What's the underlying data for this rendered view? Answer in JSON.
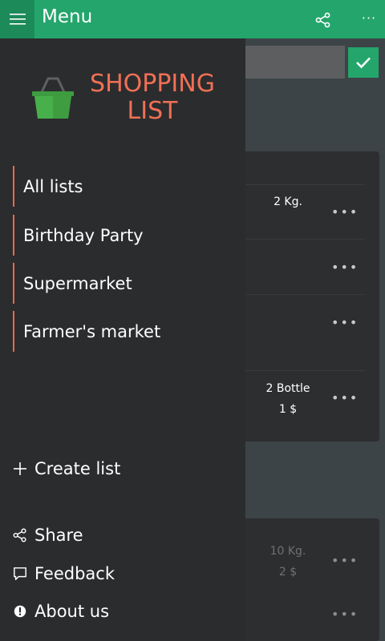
{
  "header": {
    "title": "Menu",
    "hamburger_icon": "hamburger-icon",
    "share_icon": "share-icon",
    "more_glyph": "···"
  },
  "brand": {
    "line1": "SHOPPING",
    "line2": "LIST",
    "logo_icon": "basket-icon",
    "accent_color": "#f07055"
  },
  "nav": {
    "items": [
      {
        "label": "All lists"
      },
      {
        "label": "Birthday Party"
      },
      {
        "label": "Supermarket"
      },
      {
        "label": "Farmer's market"
      }
    ]
  },
  "actions": {
    "create_list": "Create list",
    "share": "Share",
    "feedback": "Feedback",
    "about": "About us"
  },
  "background": {
    "confirm_icon": "checkmark-icon",
    "rows": [
      {
        "qty": "2 Kg.",
        "price": ""
      },
      {
        "qty": "",
        "price": ""
      },
      {
        "qty": "",
        "price": ""
      },
      {
        "qty": "2 Bottle",
        "price": "1 $"
      },
      {
        "qty": "10 Kg.",
        "price": "2 $"
      },
      {
        "qty": "",
        "price": ""
      }
    ],
    "more_glyph": "•••"
  },
  "colors": {
    "topbar": "#24a56c",
    "drawer": "#2b2c2e",
    "accent": "#e8694d"
  }
}
